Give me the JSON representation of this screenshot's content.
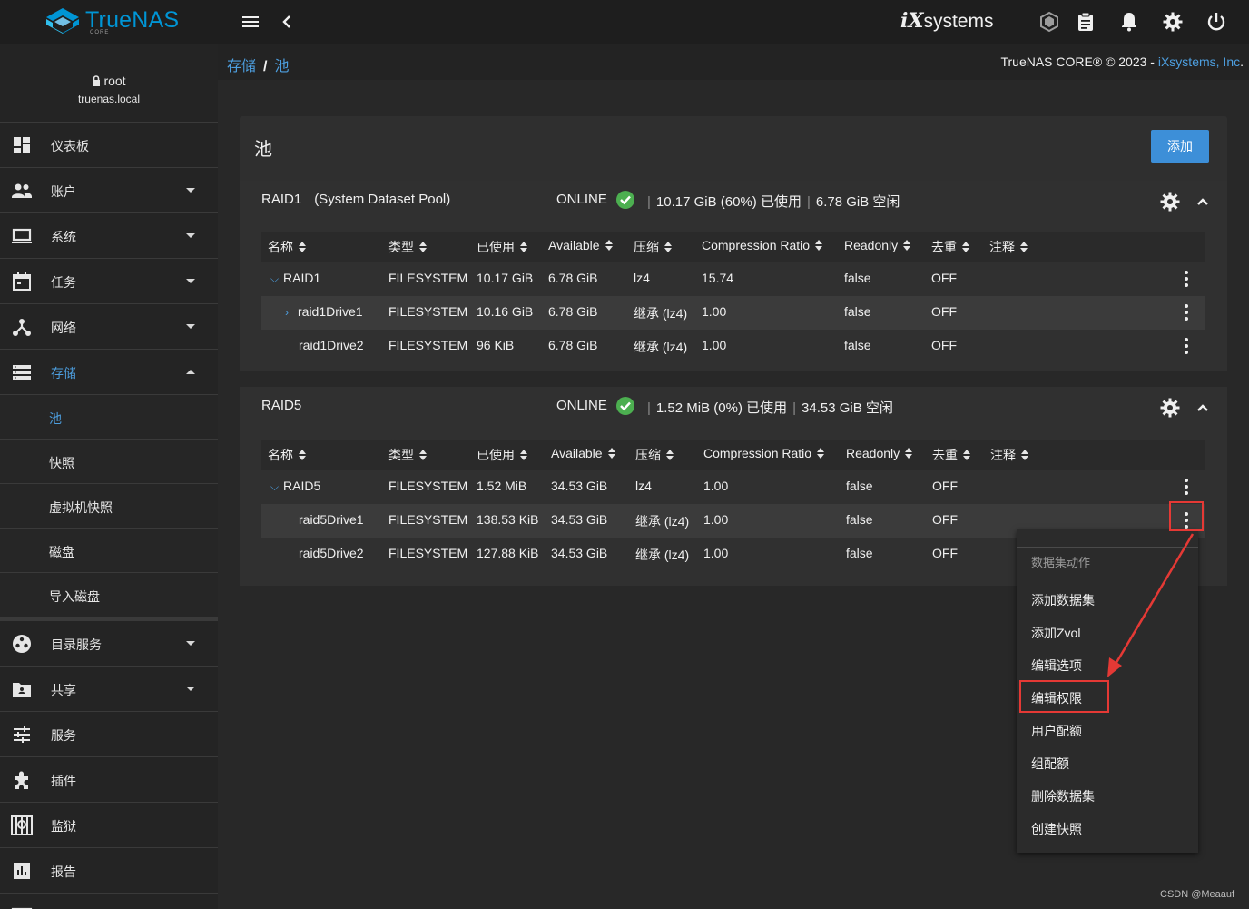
{
  "brand": {
    "name": "TrueNAS",
    "edition": "CORE"
  },
  "topbar": {
    "icons": [
      "menu-icon",
      "back-chevron-icon",
      "truecommand-icon",
      "clipboard-icon",
      "bell-icon",
      "gear-icon",
      "power-icon"
    ],
    "vendor_logo_mark": "iX",
    "vendor_logo_text": "systems"
  },
  "sidebar": {
    "user": "root",
    "host": "truenas.local",
    "items": [
      {
        "label": "仪表板",
        "icon": "dashboard-icon"
      },
      {
        "label": "账户",
        "icon": "people-icon"
      },
      {
        "label": "系统",
        "icon": "laptop-icon"
      },
      {
        "label": "任务",
        "icon": "calendar-icon"
      },
      {
        "label": "网络",
        "icon": "network-icon"
      },
      {
        "label": "存储",
        "icon": "storage-icon"
      }
    ],
    "storage_sub": [
      "池",
      "快照",
      "虚拟机快照",
      "磁盘",
      "导入磁盘"
    ],
    "items2": [
      {
        "label": "目录服务",
        "icon": "directory-icon"
      },
      {
        "label": "共享",
        "icon": "share-icon"
      },
      {
        "label": "服务",
        "icon": "sliders-icon"
      },
      {
        "label": "插件",
        "icon": "puzzle-icon"
      },
      {
        "label": "监狱",
        "icon": "jail-icon"
      },
      {
        "label": "报告",
        "icon": "report-icon"
      }
    ]
  },
  "breadcrumb": {
    "root": "存储",
    "current": "池"
  },
  "copyright": {
    "text": "TrueNAS CORE® © 2023 - ",
    "link": "iXsystems, Inc",
    "suffix": "."
  },
  "page": {
    "title": "池",
    "add_label": "添加"
  },
  "columns": [
    "名称",
    "类型",
    "已使用",
    "Available",
    "压缩",
    "Compression Ratio",
    "Readonly",
    "去重",
    "注释"
  ],
  "pools": [
    {
      "name": "RAID1",
      "tag": "(System Dataset Pool)",
      "status": "ONLINE",
      "used": "10.17 GiB (60%) 已使用",
      "free": "6.78 GiB 空闲",
      "rows": [
        {
          "name": "RAID1",
          "type": "FILESYSTEM",
          "used": "10.17 GiB",
          "avail": "6.78 GiB",
          "comp": "lz4",
          "ratio": "15.74",
          "ro": "false",
          "dedup": "OFF"
        },
        {
          "name": "raid1Drive1",
          "type": "FILESYSTEM",
          "used": "10.16 GiB",
          "avail": "6.78 GiB",
          "comp": "继承 (lz4)",
          "ratio": "1.00",
          "ro": "false",
          "dedup": "OFF"
        },
        {
          "name": "raid1Drive2",
          "type": "FILESYSTEM",
          "used": "96 KiB",
          "avail": "6.78 GiB",
          "comp": "继承 (lz4)",
          "ratio": "1.00",
          "ro": "false",
          "dedup": "OFF"
        }
      ]
    },
    {
      "name": "RAID5",
      "tag": "",
      "status": "ONLINE",
      "used": "1.52 MiB (0%) 已使用",
      "free": "34.53 GiB 空闲",
      "rows": [
        {
          "name": "RAID5",
          "type": "FILESYSTEM",
          "used": "1.52 MiB",
          "avail": "34.53 GiB",
          "comp": "lz4",
          "ratio": "1.00",
          "ro": "false",
          "dedup": "OFF"
        },
        {
          "name": "raid5Drive1",
          "type": "FILESYSTEM",
          "used": "138.53 KiB",
          "avail": "34.53 GiB",
          "comp": "继承 (lz4)",
          "ratio": "1.00",
          "ro": "false",
          "dedup": "OFF"
        },
        {
          "name": "raid5Drive2",
          "type": "FILESYSTEM",
          "used": "127.88 KiB",
          "avail": "34.53 GiB",
          "comp": "继承 (lz4)",
          "ratio": "1.00",
          "ro": "false",
          "dedup": "OFF"
        }
      ]
    }
  ],
  "menu": {
    "title": "数据集动作",
    "items": [
      "添加数据集",
      "添加Zvol",
      "编辑选项",
      "编辑权限",
      "用户配额",
      "组配额",
      "删除数据集",
      "创建快照"
    ]
  },
  "colors": {
    "accent": "#3d8fd8",
    "online": "#4caf50",
    "highlight": "#e53935"
  },
  "watermark": "CSDN @Meaauf"
}
